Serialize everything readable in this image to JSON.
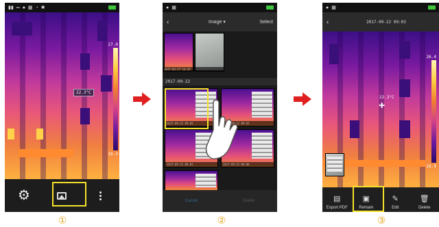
{
  "steps": [
    "①",
    "②",
    "③"
  ],
  "colors": {
    "highlight": "#f7e32a",
    "arrow": "#e02020",
    "step_number": "#e8a21a"
  },
  "phone1": {
    "statusbar_icons": [
      "signal-icon",
      "usb-icon",
      "location-icon",
      "grid-icon",
      "zoom-icon",
      "settings-icon"
    ],
    "scale_max": "27.0",
    "scale_min": "16.3",
    "spot_temp": "22.3°C",
    "bottom_bar": [
      "settings-gear-icon",
      "gallery-icon",
      "more-options-icon"
    ]
  },
  "phone2": {
    "title": "Image ▾",
    "select_label": "Select",
    "older_caption": "2017-04-27 14:35",
    "date_header": "2017-09-22",
    "thumb_captions": [
      "2017-09-22 09:03",
      "2017-09-22 09:03",
      "2017-09-22 09:01",
      "2017-09-22 09:00"
    ],
    "footer": {
      "cancel": "Cancel",
      "delete": "Delete"
    }
  },
  "phone3": {
    "title": "2017-09-22 09:03",
    "scale_max": "26.4",
    "scale_min": "16.9",
    "spot_temp": "22.3°C",
    "actions": [
      {
        "label": "Export PDF",
        "icon": "pdf-icon"
      },
      {
        "label": "Remark",
        "icon": "remark-icon"
      },
      {
        "label": "Edit",
        "icon": "edit-icon"
      },
      {
        "label": "Delete",
        "icon": "trash-icon"
      }
    ]
  }
}
